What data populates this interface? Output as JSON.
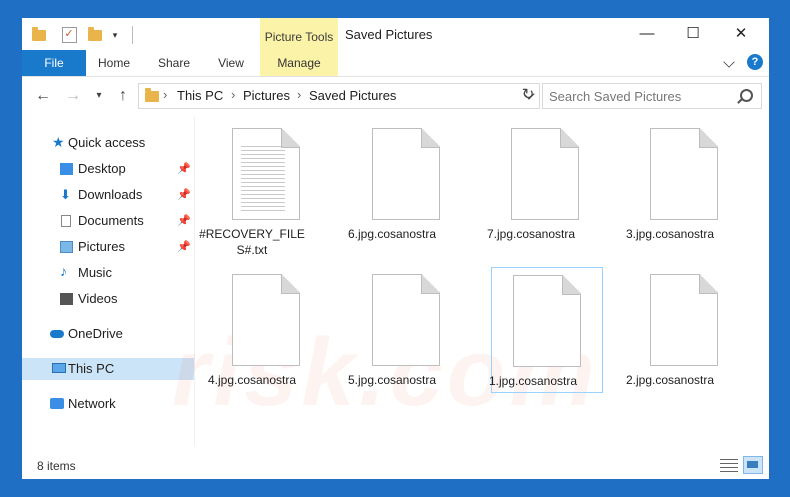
{
  "titlebar": {
    "picture_tools": "Picture Tools",
    "title": "Saved Pictures",
    "minimize": "—",
    "maximize": "☐",
    "close": "✕"
  },
  "ribbon": {
    "tabs": [
      "File",
      "Home",
      "Share",
      "View",
      "Manage"
    ],
    "help": "?"
  },
  "address": {
    "crumbs": [
      "This PC",
      "Pictures",
      "Saved Pictures"
    ],
    "search_placeholder": "Search Saved Pictures"
  },
  "nav": {
    "quick_access": "Quick access",
    "pinned": [
      "Desktop",
      "Downloads",
      "Documents",
      "Pictures"
    ],
    "unpinned": [
      "Music",
      "Videos"
    ],
    "onedrive": "OneDrive",
    "this_pc": "This PC",
    "network": "Network"
  },
  "files": [
    {
      "name": "#RECOVERY_FILES#.txt",
      "type": "text"
    },
    {
      "name": "6.jpg.cosanostra",
      "type": "blank"
    },
    {
      "name": "7.jpg.cosanostra",
      "type": "blank"
    },
    {
      "name": "3.jpg.cosanostra",
      "type": "blank"
    },
    {
      "name": "4.jpg.cosanostra",
      "type": "blank"
    },
    {
      "name": "5.jpg.cosanostra",
      "type": "blank"
    },
    {
      "name": "1.jpg.cosanostra",
      "type": "blank",
      "selected": true
    },
    {
      "name": "2.jpg.cosanostra",
      "type": "blank"
    }
  ],
  "status": {
    "count": "8 items"
  },
  "colors": {
    "accent": "#1979ca",
    "picture_tools": "#fbf3a8",
    "selection": "#cce4f7"
  }
}
